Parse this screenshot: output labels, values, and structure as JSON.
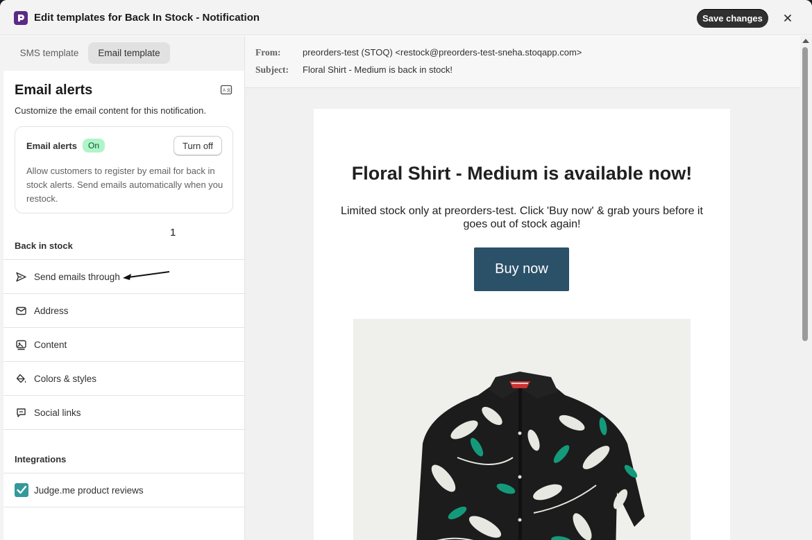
{
  "header": {
    "title": "Edit templates for Back In Stock - Notification",
    "save_label": "Save changes"
  },
  "tabs": [
    {
      "label": "SMS template",
      "active": false
    },
    {
      "label": "Email template",
      "active": true
    }
  ],
  "alerts": {
    "title": "Email alerts",
    "description": "Customize the email content for this notification.",
    "card": {
      "label": "Email alerts",
      "status": "On",
      "button_label": "Turn off",
      "description": "Allow customers to register by email for back in stock alerts. Send emails automatically when you restock."
    }
  },
  "back_in_stock": {
    "heading": "Back in stock",
    "items": [
      {
        "label": "Send emails through",
        "icon": "send-icon"
      },
      {
        "label": "Address",
        "icon": "envelope-icon"
      },
      {
        "label": "Content",
        "icon": "image-content-icon"
      },
      {
        "label": "Colors & styles",
        "icon": "paint-bucket-icon"
      },
      {
        "label": "Social links",
        "icon": "social-chat-icon"
      }
    ]
  },
  "integrations": {
    "heading": "Integrations",
    "items": [
      {
        "label": "Judge.me product reviews",
        "icon": "judgeme-logo-icon"
      }
    ]
  },
  "annotation": {
    "number": "1"
  },
  "email": {
    "from_label": "From:",
    "from_value": "preorders-test (STOQ) <restock@preorders-test-sneha.stoqapp.com>",
    "subject_label": "Subject:",
    "subject_value": "Floral Shirt - Medium is back in stock!",
    "heading": "Floral Shirt - Medium is available now!",
    "body": "Limited stock only at preorders-test. Click 'Buy now' & grab yours before it goes out of stock again!",
    "button_label": "Buy now",
    "button_color": "#2b5169"
  },
  "colors": {
    "accent_dark": "#303030",
    "badge_green": "#aff5c7",
    "app_purple": "#5b2a86"
  }
}
